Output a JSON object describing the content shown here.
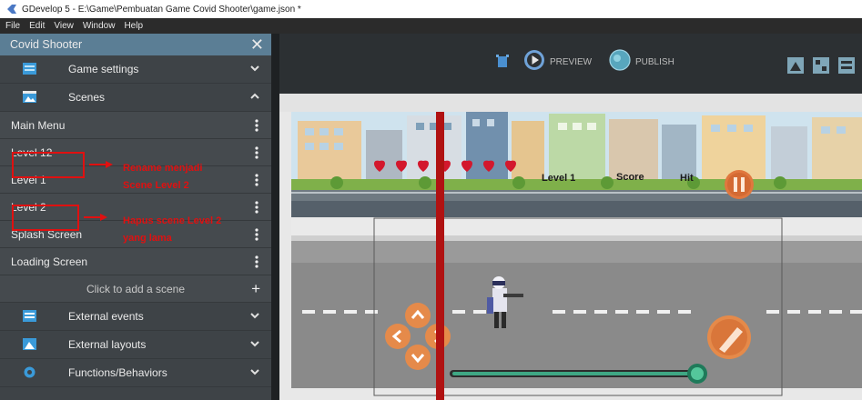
{
  "window": {
    "title": "GDevelop 5 - E:\\Game\\Pembuatan Game Covid Shooter\\game.json *"
  },
  "menubar": [
    "File",
    "Edit",
    "View",
    "Window",
    "Help"
  ],
  "project": {
    "name": "Covid Shooter",
    "sections": {
      "game_settings": "Game settings",
      "scenes": "Scenes",
      "external_events": "External events",
      "external_layouts": "External layouts",
      "functions": "Functions/Behaviors"
    },
    "scenes": [
      "Main Menu",
      "Level 12",
      "Level 1",
      "Level 2",
      "Splash Screen",
      "Loading Screen"
    ],
    "add_scene": "Click to add a scene"
  },
  "annotations": {
    "rename": [
      "Rename menjadi",
      "Scene Level 2"
    ],
    "delete": [
      "Hapus scene Level 2",
      "yang lama"
    ]
  },
  "toolbar": {
    "preview": "PREVIEW",
    "publish": "PUBLISH"
  },
  "game": {
    "level_label": "Level 1",
    "score_label": "Score",
    "hit_label": "Hit"
  },
  "colors": {
    "sidebar_header": "#5b7e95",
    "sidebar_bg": "#3e4347",
    "annotation": "#e01010",
    "toolbar_bg": "#2c3033"
  },
  "icons": {
    "preview": "play-circle-icon",
    "publish": "globe-icon",
    "close": "close-icon"
  }
}
